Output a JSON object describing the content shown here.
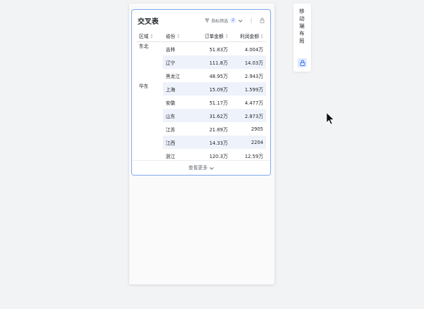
{
  "card": {
    "title": "交叉表",
    "filter_label": "指标筛选",
    "filter_count": "2",
    "view_more": "查看更多"
  },
  "table": {
    "headers": {
      "region": "区域",
      "province": "省份",
      "order_amount": "订单金额",
      "profit_amount": "利润金额"
    },
    "rows": [
      {
        "region": "东北",
        "province": "吉林",
        "order": "51.83万",
        "profit": "4.004万"
      },
      {
        "region": "",
        "province": "辽宁",
        "order": "111.8万",
        "profit": "14.03万"
      },
      {
        "region": "",
        "province": "黑龙江",
        "order": "48.95万",
        "profit": "2.943万"
      },
      {
        "region": "华东",
        "province": "上海",
        "order": "15.09万",
        "profit": "1.599万"
      },
      {
        "region": "",
        "province": "安徽",
        "order": "51.17万",
        "profit": "4.477万"
      },
      {
        "region": "",
        "province": "山东",
        "order": "31.62万",
        "profit": "2.873万"
      },
      {
        "region": "",
        "province": "江苏",
        "order": "21.89万",
        "profit": "2905"
      },
      {
        "region": "",
        "province": "江西",
        "order": "14.33万",
        "profit": "2204"
      },
      {
        "region": "",
        "province": "浙江",
        "order": "120.3万",
        "profit": "12.59万"
      }
    ]
  },
  "side_panel": {
    "label": "移动端布局"
  },
  "colors": {
    "accent": "#3370ff",
    "card_border": "#7fa7ef",
    "stripe": "#eef2fb"
  },
  "icons": {
    "filter": "filter-lines-icon",
    "more": "more-vertical-icon",
    "lock": "lock-icon",
    "sort": "sort-icon",
    "chevron": "chevron-down-icon",
    "cursor": "mouse-pointer-icon"
  }
}
